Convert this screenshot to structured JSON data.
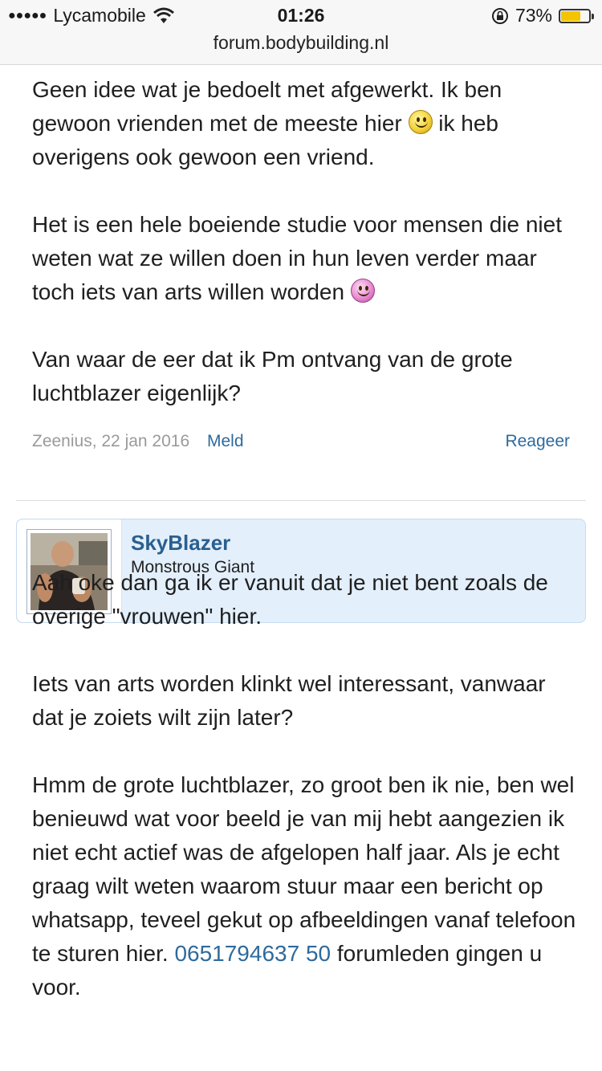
{
  "status_bar": {
    "carrier": "Lycamobile",
    "time": "01:26",
    "battery": "73%",
    "battery_level": 0.73,
    "url": "forum.bodybuilding.nl"
  },
  "post1": {
    "paragraphs": [
      {
        "before": "Geen idee wat je bedoelt met afgewerkt. Ik ben gewoon vrienden met de meeste hier ",
        "after": " ik heb overigens ook gewoon een vriend."
      },
      {
        "before": "Het is een hele boeiende studie voor mensen die niet weten wat ze willen doen in hun leven verder maar toch iets van arts willen worden ",
        "after": ""
      },
      {
        "text": "Van waar de eer dat ik Pm ontvang van de grote luchtblazer eigenlijk?"
      }
    ],
    "meta": {
      "author_date": "Zeenius, 22 jan 2016",
      "report_label": "Meld",
      "reply_label": "Reageer"
    }
  },
  "user": {
    "name": "SkyBlazer",
    "title": "Monstrous Giant"
  },
  "post2": {
    "paragraphs": [
      "Aah oke dan ga ik er vanuit dat je niet bent zoals de overige \"vrouwen\" hier.",
      "Iets van arts worden klinkt wel interessant, vanwaar dat je zoiets wilt zijn later?"
    ],
    "last_paragraph": "Hmm de grote luchtblazer, zo groot ben ik nie, ben wel benieuwd wat voor beeld je van mij hebt aangezien ik niet echt actief was de afgelopen half jaar. Als je echt graag wilt weten waarom stuur maar een bericht op whatsapp, teveel gekut op afbeeldingen vanaf telefoon te sturen hier.",
    "phone": "0651794637 50",
    "trailing": " forumleden gingen u voor."
  }
}
